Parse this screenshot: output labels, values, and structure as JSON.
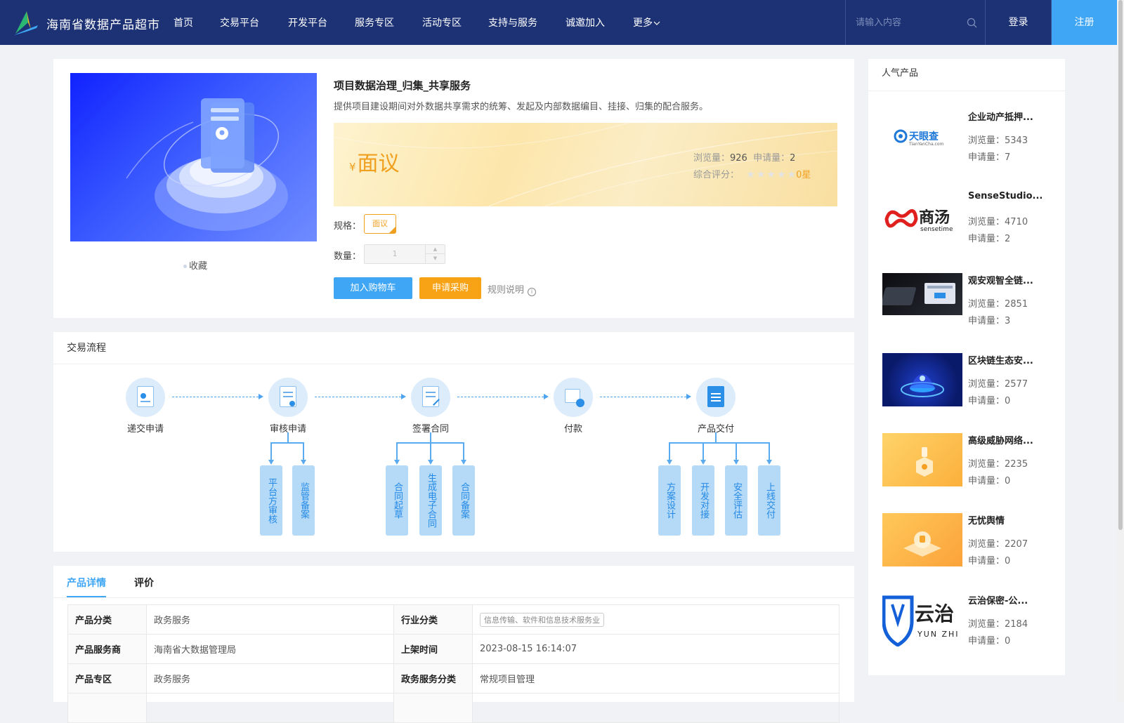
{
  "header": {
    "brand": "海南省数据产品超市",
    "nav": [
      "首页",
      "交易平台",
      "开发平台",
      "服务专区",
      "活动专区",
      "支持与服务",
      "诚邀加入",
      "更多"
    ],
    "search_placeholder": "请输入内容",
    "login": "登录",
    "register": "注册",
    "colors": {
      "bg": "#1c3275",
      "accent": "#3ea6f5"
    }
  },
  "product": {
    "title": "项目数据治理_归集_共享服务",
    "desc": "提供项目建设期间对外数据共享需求的统筹、发起及内部数据编目、挂接、归集的配合服务。",
    "currency": "¥",
    "price": "面议",
    "views_label": "浏览量：",
    "views": "926",
    "apply_label": "申请量：",
    "applies": "2",
    "rating_label": "综合评分：",
    "rating": "0星",
    "rating_value": 0,
    "spec_label": "规格：",
    "spec_value": "面议",
    "qty_label": "数量：",
    "qty_value": "1",
    "add_cart": "加入购物车",
    "apply_buy": "申请采购",
    "rules": "规则说明",
    "favorite": "收藏",
    "colors": {
      "price": "#f0a020",
      "primary": "#3ea6f5",
      "warn": "#f8a315"
    }
  },
  "flow": {
    "title": "交易流程",
    "steps": [
      "递交申请",
      "审核申请",
      "签署合同",
      "付款",
      "产品交付"
    ],
    "subs": [
      [
        "平台方审核",
        "监管备案"
      ],
      [
        "合同起草",
        "生成电子合同",
        "合同备案"
      ],
      [],
      [
        "方案设计",
        "开发对接",
        "安全评估",
        "上线交付"
      ]
    ]
  },
  "details": {
    "tabs": [
      "产品详情",
      "评价"
    ],
    "rows": [
      [
        "产品分类",
        "政务服务",
        "行业分类",
        "信息传输、软件和信息技术服务业"
      ],
      [
        "产品服务商",
        "海南省大数据管理局",
        "上架时间",
        "2023-08-15 16:14:07"
      ],
      [
        "产品专区",
        "政务服务",
        "政务服务分类",
        "常规项目管理"
      ]
    ]
  },
  "sidebar": {
    "title": "人气产品",
    "views_label": "浏览量：",
    "apply_label": "申请量：",
    "items": [
      {
        "name": "企业动产抵押...",
        "views": "5343",
        "applies": "7",
        "thumb": "tianyancha-logo"
      },
      {
        "name": "SenseStudio...",
        "views": "4710",
        "applies": "2",
        "thumb": "sensetime-logo"
      },
      {
        "name": "观安观智全链...",
        "views": "2851",
        "applies": "3",
        "thumb": "device-photo"
      },
      {
        "name": "区块链生态安...",
        "views": "2577",
        "applies": "0",
        "thumb": "blockchain-illustration"
      },
      {
        "name": "高级威胁网络...",
        "views": "2235",
        "applies": "0",
        "thumb": "orange-illustration"
      },
      {
        "name": "无忧舆情",
        "views": "2207",
        "applies": "0",
        "thumb": "orange-illustration"
      },
      {
        "name": "云治保密-公...",
        "views": "2184",
        "applies": "0",
        "thumb": "yunzhi-logo"
      }
    ],
    "logos": {
      "tianyancha": "天眼查",
      "tianyancha_sub": "TianYanCha.com",
      "sensetime": "商汤",
      "sensetime_sub": "sensetime",
      "yunzhi": "云治",
      "yunzhi_sub": "YUN ZHI"
    }
  }
}
